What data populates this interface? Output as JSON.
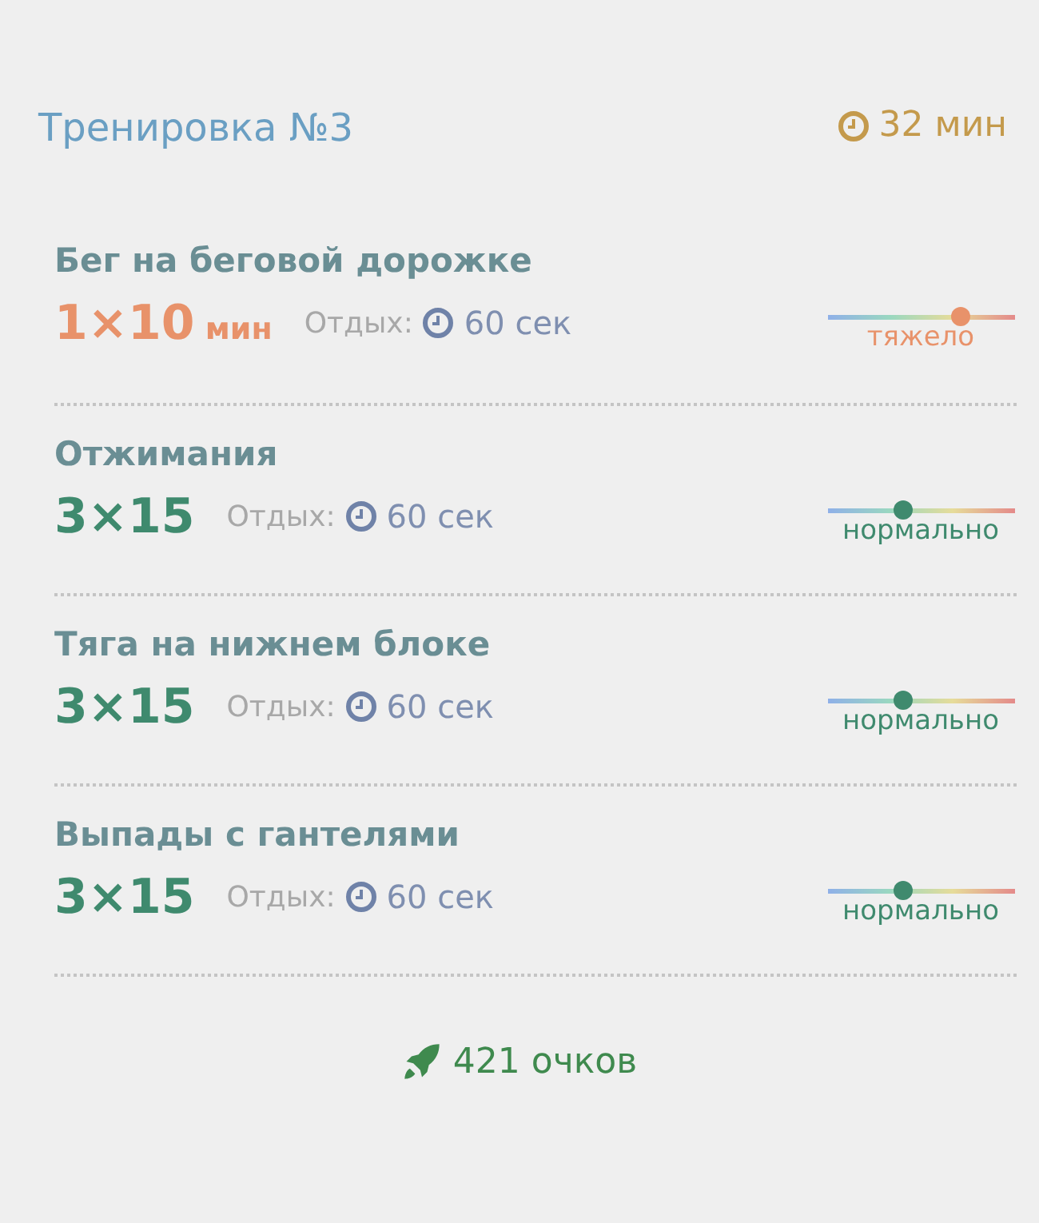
{
  "header": {
    "title": "Тренировка №3",
    "duration": "32 мин"
  },
  "exercises": [
    {
      "name": "Бег на беговой дорожке",
      "sets": "1×10",
      "unit": "мин",
      "rest_label": "Отдых:",
      "rest": "60 сек",
      "kind": "hard",
      "difficulty_label": "тяжело",
      "level": 0.71
    },
    {
      "name": "Отжимания",
      "sets": "3×15",
      "rest_label": "Отдых:",
      "rest": "60 сек",
      "kind": "normal",
      "difficulty_label": "нормально",
      "level": 0.41
    },
    {
      "name": "Тяга на нижнем блоке",
      "sets": "3×15",
      "rest_label": "Отдых:",
      "rest": "60 сек",
      "kind": "normal",
      "difficulty_label": "нормально",
      "level": 0.41
    },
    {
      "name": "Выпады с гантелями",
      "sets": "3×15",
      "rest_label": "Отдых:",
      "rest": "60 сек",
      "kind": "normal",
      "difficulty_label": "нормально",
      "level": 0.41
    }
  ],
  "points": "421 очков"
}
